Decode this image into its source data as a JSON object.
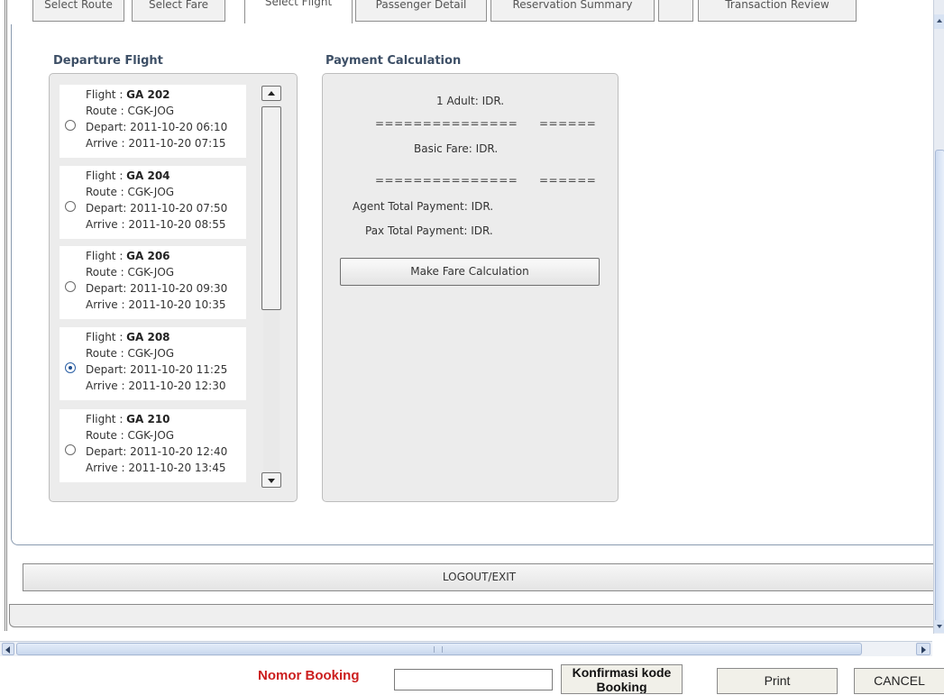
{
  "tabs": [
    {
      "label": "Select Route"
    },
    {
      "label": "Select Fare"
    },
    {
      "label": "Select Flight",
      "active": true
    },
    {
      "label": "Passenger Detail"
    },
    {
      "label": "Reservation Summary"
    },
    {
      "label": ""
    },
    {
      "label": "Transaction Review"
    }
  ],
  "departure": {
    "heading": "Departure Flight",
    "flights": [
      {
        "flight_label": "Flight : ",
        "number": "GA 202",
        "route": "Route : CGK-JOG",
        "depart": "Depart: 2011-10-20 06:10",
        "arrive": "Arrive : 2011-10-20 07:15",
        "selected": false
      },
      {
        "flight_label": "Flight : ",
        "number": "GA 204",
        "route": "Route : CGK-JOG",
        "depart": "Depart: 2011-10-20 07:50",
        "arrive": "Arrive : 2011-10-20 08:55",
        "selected": false
      },
      {
        "flight_label": "Flight : ",
        "number": "GA 206",
        "route": "Route : CGK-JOG",
        "depart": "Depart: 2011-10-20 09:30",
        "arrive": "Arrive : 2011-10-20 10:35",
        "selected": false
      },
      {
        "flight_label": "Flight : ",
        "number": "GA 208",
        "route": "Route : CGK-JOG",
        "depart": "Depart: 2011-10-20 11:25",
        "arrive": "Arrive : 2011-10-20 12:30",
        "selected": true
      },
      {
        "flight_label": "Flight : ",
        "number": "GA 210",
        "route": "Route : CGK-JOG",
        "depart": "Depart: 2011-10-20 12:40",
        "arrive": "Arrive : 2011-10-20 13:45",
        "selected": false
      }
    ]
  },
  "payment": {
    "heading": "Payment Calculation",
    "adult_line": "1 Adult: IDR.",
    "separator_long": "===============",
    "separator_short": "======",
    "basic_fare": "Basic Fare: IDR.",
    "agent_total": "Agent Total Payment: IDR.",
    "pax_total": "Pax Total Payment: IDR.",
    "calc_button": "Make Fare Calculation"
  },
  "logout_button": "LOGOUT/EXIT",
  "footer": {
    "booking_label": "Nomor Booking",
    "booking_value": "",
    "confirm_button": "Konfirmasi kode\nBooking",
    "print_button": "Print",
    "cancel_button": "CANCEL"
  },
  "colors": {
    "heading": "#3d4f66",
    "booking_label": "#cc1e1e",
    "panel_bg": "#ececec",
    "scroll_accent": "#cfdcf1"
  },
  "icons": {
    "scroll_up": "triangle-up-icon",
    "scroll_down": "triangle-down-icon",
    "scroll_left": "triangle-left-icon",
    "scroll_right": "triangle-right-icon",
    "radio": "radio-button-icon"
  }
}
